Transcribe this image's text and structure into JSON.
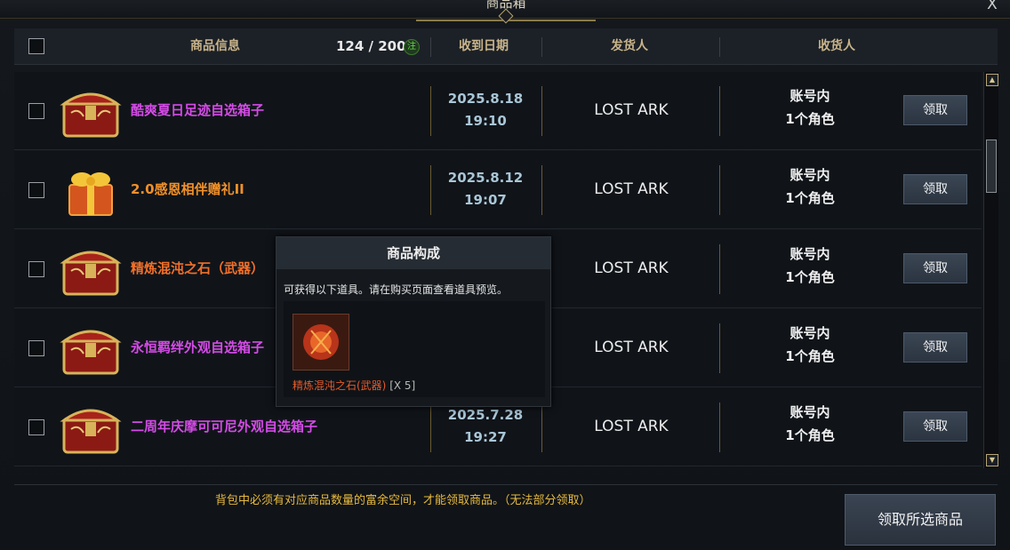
{
  "window": {
    "title": "商品箱",
    "close_label": "X"
  },
  "header": {
    "col_info": "商品信息",
    "count": "124 / 200",
    "note_badge": "注",
    "col_date": "收到日期",
    "col_sender": "发货人",
    "col_recipient": "收货人"
  },
  "rows": [
    {
      "name": "酷爽夏日足迹自选箱子",
      "name_color": "#d44be6",
      "date": "2025.8.18",
      "time": "19:10",
      "sender": "LOST ARK",
      "recipient_1": "账号内",
      "recipient_2": "1个角色",
      "button": "领取",
      "icon": "red-chest-icon"
    },
    {
      "name": "2.0感恩相伴赠礼II",
      "name_color": "#f0902a",
      "date": "2025.8.12",
      "time": "19:07",
      "sender": "LOST ARK",
      "recipient_1": "账号内",
      "recipient_2": "1个角色",
      "button": "领取",
      "icon": "gift-box-icon"
    },
    {
      "name": "精炼混沌之石（武器）",
      "name_color": "#f0702a",
      "date": "",
      "time": "",
      "sender": "LOST ARK",
      "recipient_1": "账号内",
      "recipient_2": "1个角色",
      "button": "领取",
      "icon": "red-chest-icon"
    },
    {
      "name": "永恒羁绊外观自选箱子",
      "name_color": "#d44be6",
      "date": "",
      "time": "",
      "sender": "LOST ARK",
      "recipient_1": "账号内",
      "recipient_2": "1个角色",
      "button": "领取",
      "icon": "red-chest-icon"
    },
    {
      "name": "二周年庆摩可可尼外观自选箱子",
      "name_color": "#d44be6",
      "date": "2025.7.28",
      "time": "19:27",
      "sender": "LOST ARK",
      "recipient_1": "账号内",
      "recipient_2": "1个角色",
      "button": "领取",
      "icon": "red-chest-icon"
    }
  ],
  "tooltip": {
    "title": "商品构成",
    "description": "可获得以下道具。请在购买页面查看道具预览。",
    "item_name": "精炼混沌之石(武器)",
    "item_qty": "[X 5]"
  },
  "footer": {
    "note": "背包中必须有对应商品数量的富余空间，才能领取商品。（无法部分领取）",
    "claim_all": "领取所选商品"
  }
}
